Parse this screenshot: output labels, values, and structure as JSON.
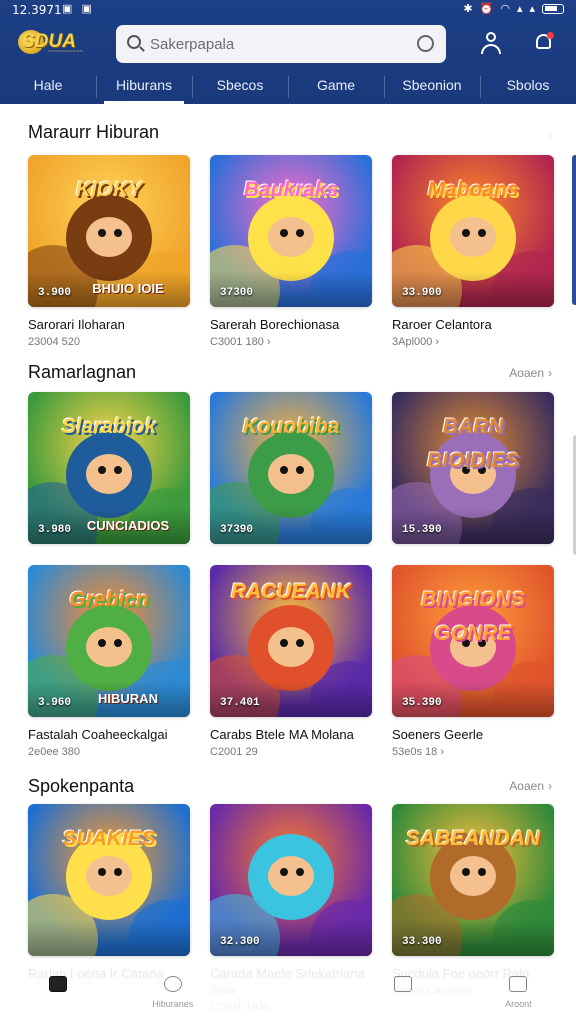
{
  "status_bar": {
    "time": "12.3971",
    "left_icons": "▣ ▣"
  },
  "app": {
    "logo_text": "SDUA",
    "logo_sub": "~~~~~~~~~~"
  },
  "search": {
    "placeholder": "Sakerpapala"
  },
  "tabs": [
    {
      "label": "Hale",
      "active": false
    },
    {
      "label": "Hiburans",
      "active": true
    },
    {
      "label": "Sbecos",
      "active": false
    },
    {
      "label": "Game",
      "active": false
    },
    {
      "label": "Sbeonion",
      "active": false
    },
    {
      "label": "Sbolos",
      "active": false
    }
  ],
  "sections": [
    {
      "title": "Maraurr Hiburan",
      "see_all": "",
      "cards": [
        {
          "banner": "KIOKY",
          "score": "3.900",
          "overlay": "BHUIO IOIE",
          "title": "Sarorari Iloharan",
          "meta": "23004 520",
          "palette": [
            "#f0a42a",
            "#ffd35a",
            "#7a3d12"
          ]
        },
        {
          "banner": "Baukraks",
          "score": "37300",
          "overlay": "",
          "title": "Sarerah Borechionasa",
          "meta": "C3001 180 ›",
          "palette": [
            "#2b6fd8",
            "#ff6cc8",
            "#ffe14a"
          ]
        },
        {
          "banner": "Maboans",
          "score": "33.900",
          "overlay": "",
          "title": "Raroer Celantora",
          "meta": "3Apl000 ›",
          "palette": [
            "#b0264f",
            "#ff8a2a",
            "#ffd84a"
          ]
        }
      ]
    },
    {
      "title": "Ramarlagnan",
      "see_all": "Aoaen",
      "cards": [
        {
          "banner": "Slarabiok",
          "score": "3.980",
          "overlay": "CUNCIADIOS",
          "title": "",
          "meta": "",
          "palette": [
            "#3a9a3c",
            "#ffd64a",
            "#1f5c9b"
          ]
        },
        {
          "banner": "Kouobiba",
          "score": "37390",
          "overlay": "",
          "title": "",
          "meta": "",
          "palette": [
            "#2a7ad8",
            "#ffb23a",
            "#3c9c48"
          ]
        },
        {
          "banner": "BARN BIOIDIES",
          "score": "15.390",
          "overlay": "",
          "title": "",
          "meta": "",
          "palette": [
            "#3a2d5e",
            "#e08a34",
            "#9a6eb8"
          ]
        }
      ]
    },
    {
      "title": "",
      "see_all": "",
      "cards": [
        {
          "banner": "Grebicn",
          "score": "3.960",
          "overlay": "HIBURAN",
          "title": "Fastalah Coaheeckalgai",
          "meta": "2e0ee 380",
          "palette": [
            "#2c8ad4",
            "#ff8c2a",
            "#4fae44"
          ]
        },
        {
          "banner": "RACUEANK",
          "score": "37.401",
          "overlay": "",
          "title": "Carabs Btele MA Molana",
          "meta": "C2001 29",
          "palette": [
            "#5a2aa8",
            "#ffbe3a",
            "#e0502a"
          ]
        },
        {
          "banner": "BINGIONS GONRE",
          "score": "35.390",
          "overlay": "",
          "title": "Soeners Geerle",
          "meta": "53e0s 18 ›",
          "palette": [
            "#e0542c",
            "#ff9f3a",
            "#d84a8a"
          ]
        }
      ]
    },
    {
      "title": "Spokenpanta",
      "see_all": "Aoaen",
      "cards": [
        {
          "banner": "SUAKIES",
          "score": "",
          "overlay": "",
          "title": "Rarlan I oena Ir Carana",
          "meta": "",
          "palette": [
            "#1e6fd0",
            "#ff9a2a",
            "#ffe04a"
          ]
        },
        {
          "banner": "",
          "score": "32.300",
          "overlay": "",
          "title": "Carada Maele Srlekatriana",
          "meta": "Sena",
          "meta2": "C2001 1930",
          "palette": [
            "#6a2aa8",
            "#ff7a2a",
            "#3ac4e0"
          ]
        },
        {
          "banner": "SABEANDAN",
          "score": "33.300",
          "overlay": "",
          "title": "Sucdula Foe oeorr Raln",
          "meta": "Sooen Caooane",
          "palette": [
            "#2f8a3a",
            "#ffbe3a",
            "#b06a2a"
          ]
        }
      ]
    }
  ],
  "bottom_nav": [
    {
      "label": "",
      "icon": "home-icon",
      "active": true
    },
    {
      "label": "Hiburanes",
      "icon": "games-icon",
      "active": false
    },
    {
      "label": "",
      "icon": "library-icon",
      "active": false
    },
    {
      "label": "",
      "icon": "list-icon",
      "active": false
    },
    {
      "label": "Aroont",
      "icon": "account-icon",
      "active": false
    }
  ]
}
